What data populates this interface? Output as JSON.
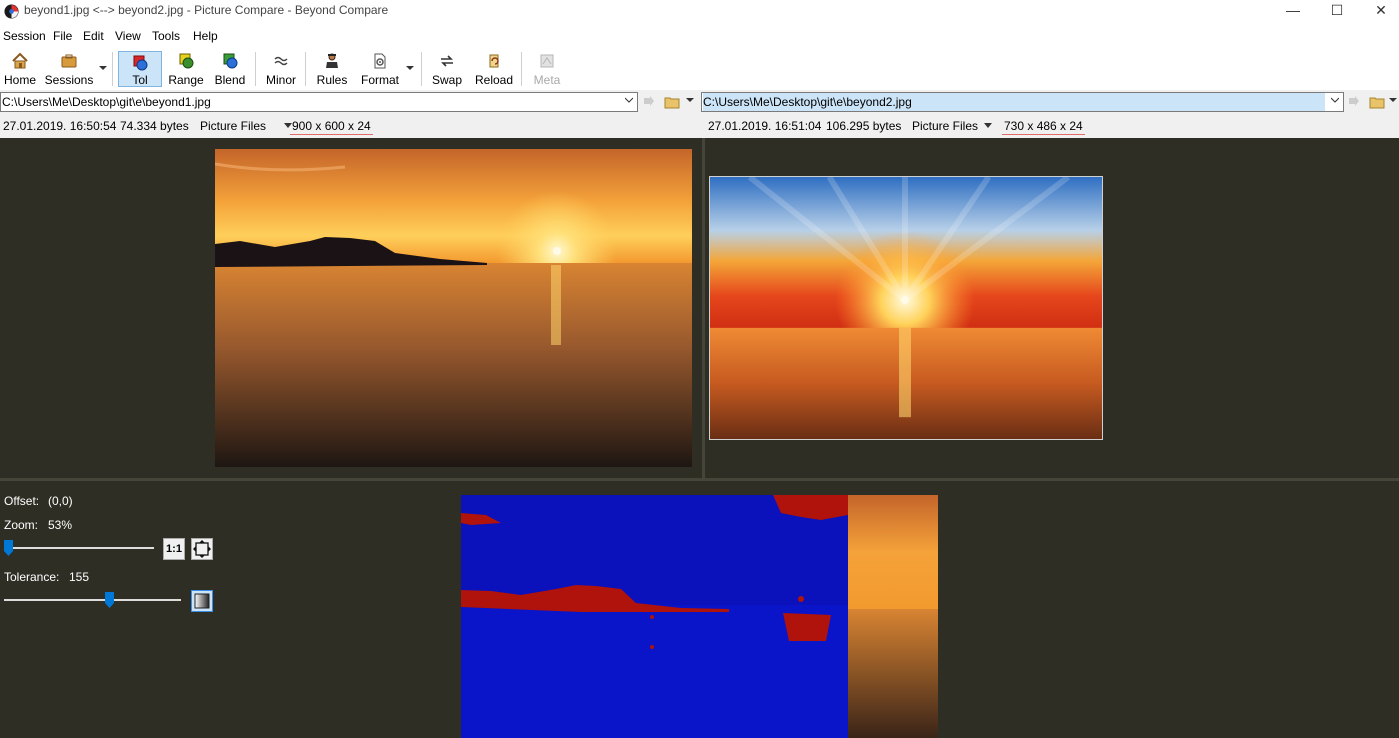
{
  "window": {
    "title": "beyond1.jpg <--> beyond2.jpg - Picture Compare - Beyond Compare",
    "minimize_glyph": "—",
    "maximize_glyph": "☐",
    "close_glyph": "✕"
  },
  "menu": {
    "items": [
      "Session",
      "File",
      "Edit",
      "View",
      "Tools",
      "Help"
    ]
  },
  "toolbar": {
    "buttons": [
      {
        "label": "Home",
        "icon": "home-icon"
      },
      {
        "label": "Sessions",
        "icon": "sessions-icon"
      },
      {
        "label": "Tol",
        "icon": "tolerance-icon",
        "active": true
      },
      {
        "label": "Range",
        "icon": "range-icon"
      },
      {
        "label": "Blend",
        "icon": "blend-icon"
      },
      {
        "label": "Minor",
        "icon": "minor-icon"
      },
      {
        "label": "Rules",
        "icon": "rules-icon"
      },
      {
        "label": "Format",
        "icon": "format-icon"
      },
      {
        "label": "Swap",
        "icon": "swap-icon"
      },
      {
        "label": "Reload",
        "icon": "reload-icon"
      },
      {
        "label": "Meta",
        "icon": "meta-icon",
        "disabled": true
      }
    ]
  },
  "left": {
    "path": "C:\\Users\\Me\\Desktop\\git\\e\\beyond1.jpg",
    "date": "27.01.2019. 16:50:54",
    "size": "74.334 bytes",
    "format": "Picture Files",
    "dims": "900 x 600 x 24"
  },
  "right": {
    "path": "C:\\Users\\Me\\Desktop\\git\\e\\beyond2.jpg",
    "date": "27.01.2019. 16:51:04",
    "size": "106.295 bytes",
    "format": "Picture Files",
    "dims": "730 x 486 x 24"
  },
  "controls": {
    "offset_label": "Offset:",
    "offset_value": "(0,0)",
    "zoom_label": "Zoom:",
    "zoom_value": "53%",
    "zoom_fraction": 0.0,
    "one_to_one_label": "1:1",
    "tolerance_label": "Tolerance:",
    "tolerance_value": "155",
    "tolerance_fraction": 0.6
  },
  "colors": {
    "accent": "#0078d7",
    "diff_same": "#0a14c8",
    "diff_different": "#b0120c",
    "background": "#2e2e25"
  }
}
